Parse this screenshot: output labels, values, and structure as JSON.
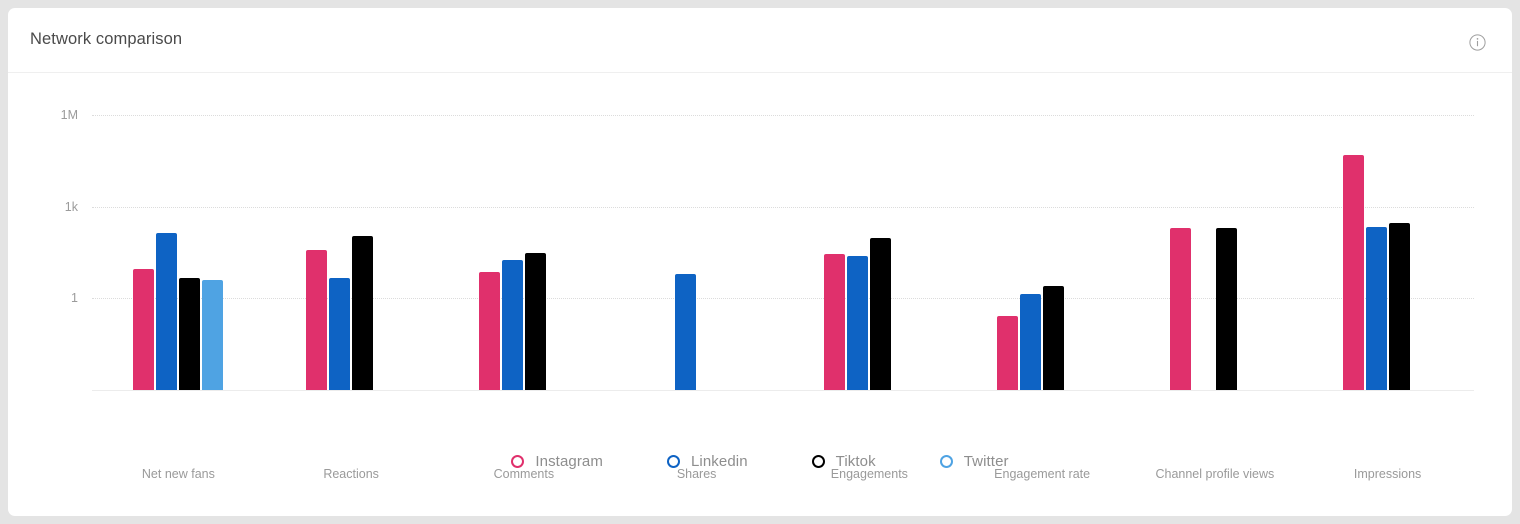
{
  "card": {
    "title": "Network comparison",
    "info_icon": "info-circle-icon"
  },
  "chart_data": {
    "type": "bar",
    "title": "Network comparison",
    "xlabel": "",
    "ylabel": "",
    "yscale": "log",
    "ytick_labels": [
      "1M",
      "1k",
      "1"
    ],
    "ytick_values": [
      1000000,
      1000,
      1
    ],
    "ylim": [
      1,
      1000000
    ],
    "grid": true,
    "legend_position": "bottom",
    "categories": [
      "Net new fans",
      "Reactions",
      "Comments",
      "Shares",
      "Engagements",
      "Engagement rate",
      "Channel profile views",
      "Impressions"
    ],
    "series": [
      {
        "name": "Instagram",
        "color": "#e0306c",
        "values": [
          9,
          37,
          7,
          null,
          27,
          0.25,
          200,
          50000
        ]
      },
      {
        "name": "Linkedin",
        "color": "#0e63c4",
        "values": [
          140,
          4.5,
          18,
          6,
          24,
          1.4,
          null,
          220
        ]
      },
      {
        "name": "Tiktok",
        "color": "#000000",
        "values": [
          4.5,
          110,
          31,
          null,
          96,
          2.4,
          200,
          290
        ]
      },
      {
        "name": "Twitter",
        "color": "#4fa3e3",
        "values": [
          4,
          null,
          null,
          null,
          null,
          null,
          null,
          null
        ]
      }
    ]
  },
  "legend": {
    "items": [
      {
        "label": "Instagram",
        "color": "#e0306c"
      },
      {
        "label": "Linkedin",
        "color": "#0e63c4"
      },
      {
        "label": "Tiktok",
        "color": "#000000"
      },
      {
        "label": "Twitter",
        "color": "#4fa3e3"
      }
    ]
  }
}
